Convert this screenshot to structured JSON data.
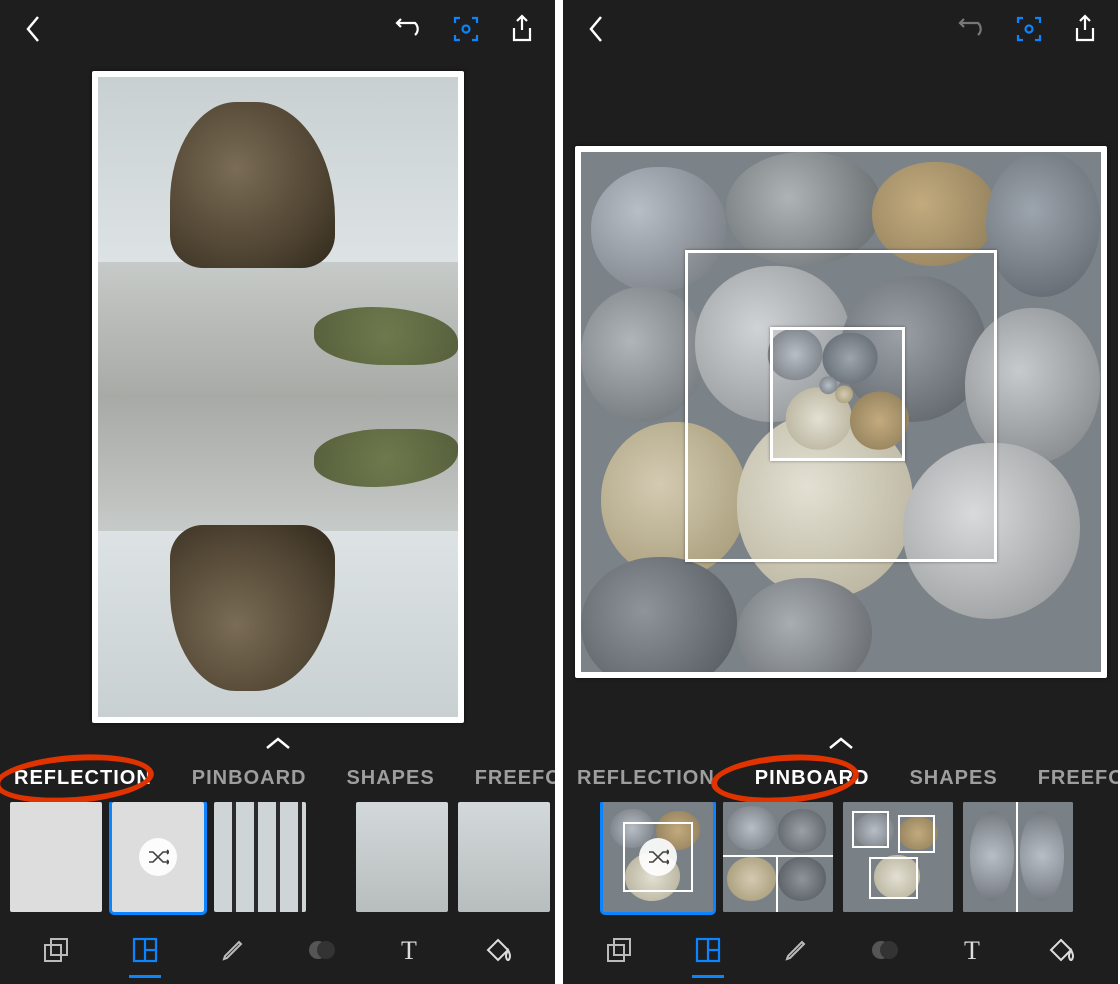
{
  "accent_color": "#0a84ff",
  "annotation_color": "#e13300",
  "left": {
    "active_tab": "REFLECTION",
    "tabs": [
      "REFLECTION",
      "PINBOARD",
      "SHAPES",
      "FREEFORMS"
    ],
    "circled_tab_index": 0,
    "selected_thumb_index": 1,
    "thumb_count_visible": 6,
    "bottom_active_index": 1
  },
  "right": {
    "active_tab": "PINBOARD",
    "tabs": [
      "REFLECTION",
      "PINBOARD",
      "SHAPES",
      "FREEFORMS"
    ],
    "circled_tab_index": 1,
    "selected_thumb_index": 0,
    "thumb_count_visible": 4,
    "bottom_active_index": 1
  },
  "icons": {
    "back": "chevron-left",
    "undo": "undo-arrow",
    "scan": "focus-frame",
    "share": "share-up",
    "expand": "chevron-up",
    "shuffle": "shuffle"
  },
  "bottom_tools": [
    "layers",
    "grid-layout",
    "pencil",
    "overlap-circles",
    "text",
    "paint-bucket"
  ]
}
